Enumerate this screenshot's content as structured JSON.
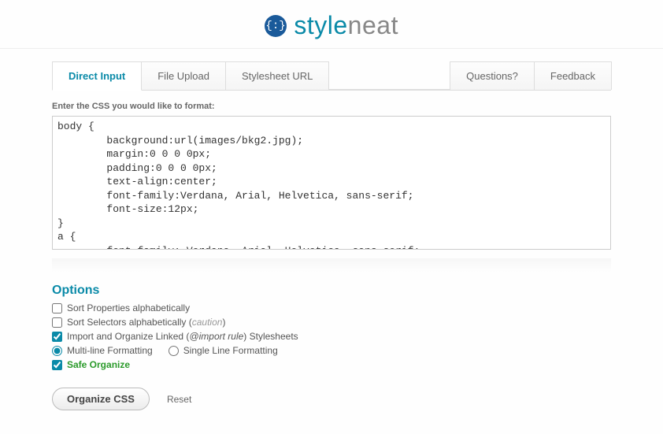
{
  "logo": {
    "badge": "{:}",
    "part1": "style",
    "part2": "neat"
  },
  "tabs": {
    "direct_input": "Direct Input",
    "file_upload": "File Upload",
    "stylesheet_url": "Stylesheet URL",
    "questions": "Questions?",
    "feedback": "Feedback"
  },
  "prompt": "Enter the CSS you would like to format:",
  "css_text": "body {\n        background:url(images/bkg2.jpg);\n        margin:0 0 0 0px;\n        padding:0 0 0 0px;\n        text-align:center;\n        font-family:Verdana, Arial, Helvetica, sans-serif;\n        font-size:12px;\n}\na {\n        font-family: Verdana, Arial, Helvetica, sans-serif;",
  "options": {
    "title": "Options",
    "sort_props": "Sort Properties alphabetically",
    "sort_selectors_pre": "Sort Selectors alphabetically (",
    "sort_selectors_caution": "caution",
    "sort_selectors_post": ")",
    "import_pre": "Import and Organize Linked (",
    "import_rule": "@import rule",
    "import_post": ") Stylesheets",
    "multi_line": "Multi-line Formatting",
    "single_line": "Single Line Formatting",
    "safe": "Safe Organize"
  },
  "actions": {
    "organize": "Organize CSS",
    "reset": "Reset"
  }
}
